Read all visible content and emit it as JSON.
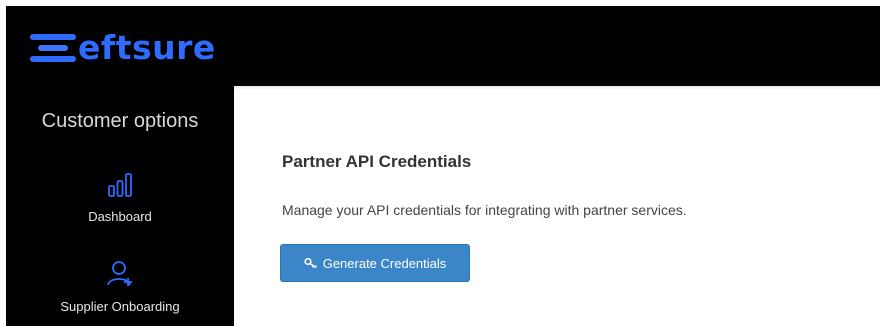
{
  "brand": {
    "name": "eftsure",
    "color": "#2f6bff"
  },
  "sidebar": {
    "title": "Customer options",
    "items": [
      {
        "label": "Dashboard",
        "icon": "bar-chart-icon"
      },
      {
        "label": "Supplier Onboarding",
        "icon": "user-add-icon"
      }
    ]
  },
  "main": {
    "title": "Partner API Credentials",
    "description": "Manage your API credentials for integrating with partner services.",
    "button": {
      "label": "Generate Credentials",
      "icon": "key-icon",
      "color": "#3a86c8"
    }
  }
}
